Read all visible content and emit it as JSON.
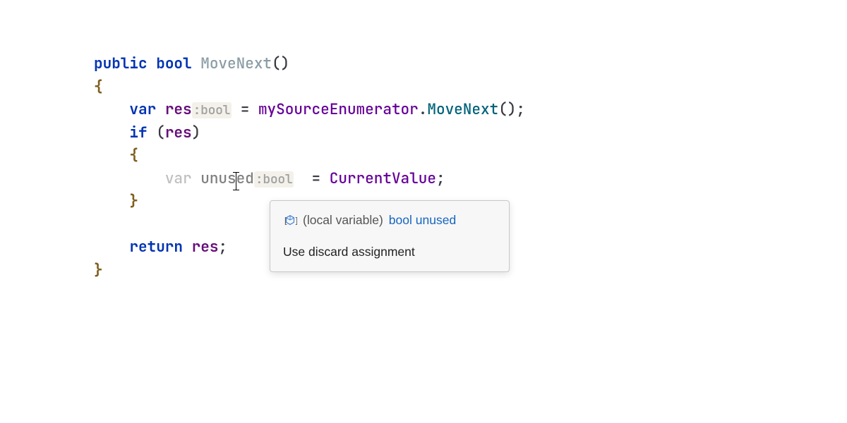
{
  "code": {
    "line1": {
      "modifier": "public",
      "type": "bool",
      "methodName": "MoveNext",
      "parens": "()"
    },
    "line2": {
      "brace": "{"
    },
    "line3": {
      "varKw": "var",
      "varName": "res",
      "hint": ":bool",
      "op": " = ",
      "field": "mySourceEnumerator",
      "dot": ".",
      "call": "MoveNext",
      "parens": "()",
      "semi": ";"
    },
    "line4": {
      "ifKw": "if",
      "open": " (",
      "cond": "res",
      "close": ")"
    },
    "line5": {
      "brace": "{"
    },
    "line6": {
      "varKw": "var",
      "namePre": "unus",
      "namePost": "ed",
      "hint": ":bool",
      "op": "  = ",
      "prop": "CurrentValue",
      "semi": ";"
    },
    "line7": {
      "brace": "}"
    },
    "line8": {
      "retKw": "return",
      "val": "res",
      "semi": ";"
    },
    "line9": {
      "brace": "}"
    }
  },
  "tooltip": {
    "localVarLabel": "(local variable)",
    "localVarType": "bool",
    "localVarName": "unused",
    "action": "Use discard assignment"
  }
}
